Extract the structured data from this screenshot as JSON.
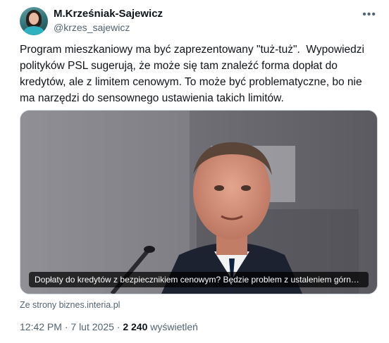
{
  "author": {
    "name": "M.Krześniak-Sajewicz",
    "handle": "@krzes_sajewicz"
  },
  "more_icon": "•••",
  "tweet": {
    "text": "Program mieszkaniowy ma być zaprezentowany \"tuż-tuż\".  Wypowiedzi polityków PSL sugerują, że może się tam znaleźć forma dopłat do kredytów, ale z limitem cenowym. To może być problematyczne, bo nie ma narzędzi do sensownego ustawienia takich limitów."
  },
  "card": {
    "image": "man-speaking-at-microphone",
    "caption": "Dopłaty do kredytów z bezpiecznikiem cenowym? Będzie problem z ustaleniem górnego limitu",
    "source": "Ze strony biznes.interia.pl"
  },
  "meta": {
    "time": "12:42 PM",
    "separator": " · ",
    "date": "7 lut 2025",
    "views_count": "2 240",
    "views_label": " wyświetleń"
  }
}
